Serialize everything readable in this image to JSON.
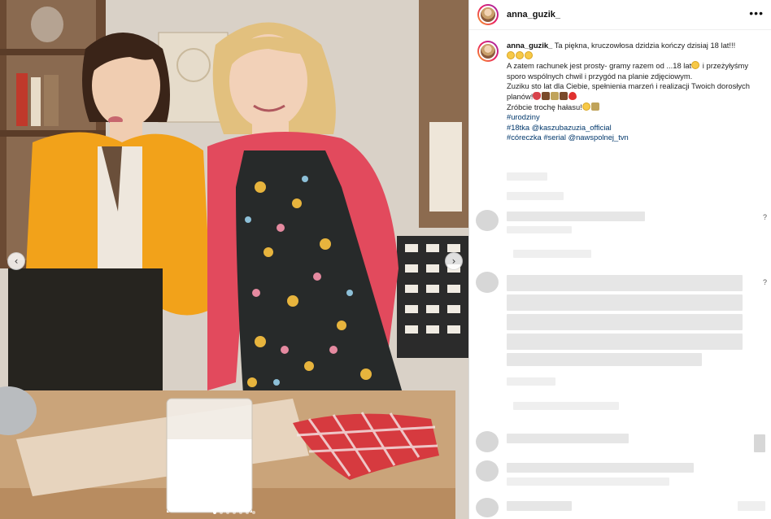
{
  "post": {
    "username": "anna_guzik_",
    "more_label": "•••"
  },
  "caption": {
    "username": "anna_guzik_",
    "line1": "Ta piękna, kruczowłosa dzidzia kończy dzisiaj 18 lat!!!",
    "line2": "A zatem rachunek jest prosty- gramy razem od ...18 lat",
    "line3": "i przeżyłyśmy sporo wspólnych chwil i przygód na planie zdjęciowym.",
    "line4": "Zuziku sto lat dla Ciebie, spełnienia marzeń i realizacji Twoich dorosłych planów!",
    "line5": "Zróbcie trochę hałasu!",
    "hashtag1": "#urodziny",
    "hashtag2": "#18tka",
    "mention1": "@kaszubazuzia_official",
    "hashtag3": "#córeczka",
    "hashtag4": "#serial",
    "mention2": "@nawspolnej_tvn"
  },
  "carousel": {
    "prev_icon": "‹",
    "next_icon": "›",
    "dot_count": 7,
    "active_dot": 0
  },
  "comments": {
    "side_glyph": "?"
  },
  "colors": {
    "link": "#00376b",
    "username": "#111111",
    "border": "#dbdbdb"
  }
}
